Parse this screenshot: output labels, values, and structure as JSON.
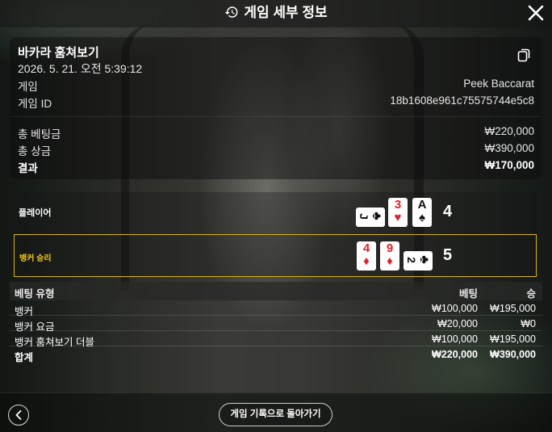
{
  "header": {
    "title": "게임 세부 정보",
    "icons": [
      "history-icon",
      "close-icon"
    ]
  },
  "summary": {
    "game_name": "바카라 훔쳐보기",
    "date": "2026. 5. 21. 오전 5:39:12",
    "rows": [
      {
        "label": "게임",
        "value": "Peek Baccarat"
      },
      {
        "label": "게임 ID",
        "value": "18b1608e961c75575744e5c8"
      }
    ],
    "totals": [
      {
        "label": "총 베팅금",
        "value": "₩220,000"
      },
      {
        "label": "총 상금",
        "value": "₩390,000"
      },
      {
        "label": "결과",
        "value": "₩170,000"
      }
    ]
  },
  "hands": {
    "player": {
      "label": "플레이어",
      "score": "4",
      "cards": [
        {
          "rank": "J",
          "suit": "♣",
          "color": "#111111",
          "orientation": "sideways"
        },
        {
          "rank": "3",
          "suit": "♥",
          "color": "#e0202a",
          "orientation": "upright"
        },
        {
          "rank": "A",
          "suit": "♠",
          "color": "#111111",
          "orientation": "upright"
        }
      ]
    },
    "banker": {
      "label": "뱅커 승리",
      "score": "5",
      "highlight_color": "#d7b317",
      "cards": [
        {
          "rank": "4",
          "suit": "♦",
          "color": "#e0202a",
          "orientation": "upright"
        },
        {
          "rank": "9",
          "suit": "♦",
          "color": "#e0202a",
          "orientation": "upright"
        },
        {
          "rank": "2",
          "suit": "♣",
          "color": "#111111",
          "orientation": "sideways"
        }
      ]
    }
  },
  "bets": {
    "headers": [
      "베팅 유형",
      "베팅",
      "승"
    ],
    "rows": [
      {
        "type": "뱅커",
        "bet": "₩100,000",
        "win": "₩195,000"
      },
      {
        "type": "뱅커 요금",
        "bet": "₩20,000",
        "win": "₩0"
      },
      {
        "type": "뱅커 훔쳐보기 더블",
        "bet": "₩100,000",
        "win": "₩195,000"
      }
    ],
    "total": {
      "type": "합계",
      "bet": "₩220,000",
      "win": "₩390,000"
    }
  },
  "footer": {
    "back_button_label": "게임 기록으로 돌아가기",
    "icons": [
      "chevron-left-icon"
    ]
  }
}
